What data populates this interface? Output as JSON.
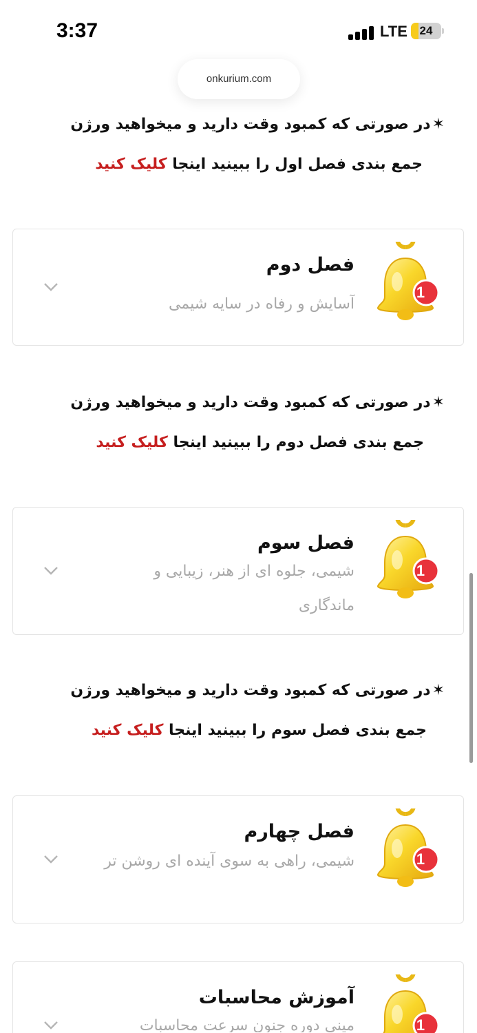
{
  "status": {
    "time": "3:37",
    "network": "LTE",
    "battery_level": "24"
  },
  "browser": {
    "url": "onkurium.com"
  },
  "colors": {
    "link": "#c61f1f",
    "subtitle": "#a8a8a8",
    "bell": "#f7cb1c",
    "badge": "#e8323b"
  },
  "notes": [
    {
      "line1": "در صورتی که کمبود وقت دارید و میخواهید ورژن",
      "line2_prefix": "جمع بندی فصل اول را ببینید اینجا",
      "link": "کلیک کنید",
      "star": "✶"
    },
    {
      "line1": "در صورتی که کمبود وقت دارید و میخواهید ورژن",
      "line2_prefix": "جمع بندی فصل دوم را ببینید اینجا",
      "link": "کلیک کنید",
      "star": "✶"
    },
    {
      "line1": "در صورتی که کمبود وقت دارید و میخواهید ورژن",
      "line2_prefix": "جمع بندی فصل سوم را ببینید اینجا",
      "link": "کلیک کنید",
      "star": "✶"
    }
  ],
  "cards": [
    {
      "title": "فصل دوم",
      "subtitle": "آسایش و رفاه در سایه شیمی",
      "badge": "1",
      "icon": "bell-icon",
      "expand_icon": "chevron-down-icon"
    },
    {
      "title": "فصل سوم",
      "subtitle": "شیمی، جلوه ای از هنر، زیبایی و ماندگاری",
      "badge": "1",
      "icon": "bell-icon",
      "expand_icon": "chevron-down-icon"
    },
    {
      "title": "فصل چهارم",
      "subtitle": "شیمی، راهی به سوی آینده ای روشن تر",
      "badge": "1",
      "icon": "bell-icon",
      "expand_icon": "chevron-down-icon"
    },
    {
      "title": "آموزش محاسبات",
      "subtitle": "مینی دوره جنون سرعت محاسبات",
      "badge": "1",
      "icon": "bell-icon",
      "expand_icon": "chevron-down-icon"
    }
  ]
}
